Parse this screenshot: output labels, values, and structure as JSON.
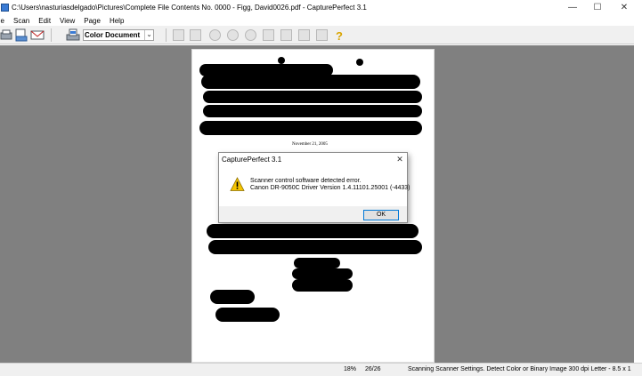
{
  "window": {
    "title": "C:\\Users\\nasturiasdelgado\\Pictures\\Complete File Contents No. 0000 - Figg, David0026.pdf - CapturePerfect 3.1",
    "minimize": "—",
    "maximize": "☐",
    "close": "✕"
  },
  "menu": {
    "items": [
      "ile",
      "Scan",
      "Edit",
      "View",
      "Page",
      "Help"
    ]
  },
  "toolbar": {
    "scan_mode": "Color Document",
    "dropdown_arrow": "⌄"
  },
  "document": {
    "date_text": "November 21, 2005"
  },
  "dialog": {
    "title": "CapturePerfect 3.1",
    "close": "✕",
    "message_line1": "Scanner control software detected error.",
    "message_line2": "Canon DR-9050C Driver Version 1.4.11101.25001 (-4433)",
    "ok_label": "OK"
  },
  "status": {
    "zoom": "18%",
    "page": "26/26",
    "settings": "Scanning Scanner Settings.  Detect Color or Binary Image  300 dpi  Letter - 8.5 x 1"
  },
  "colors": {
    "viewport_bg": "#808080",
    "warning_yellow": "#f5c400",
    "ok_border": "#0078d7"
  }
}
